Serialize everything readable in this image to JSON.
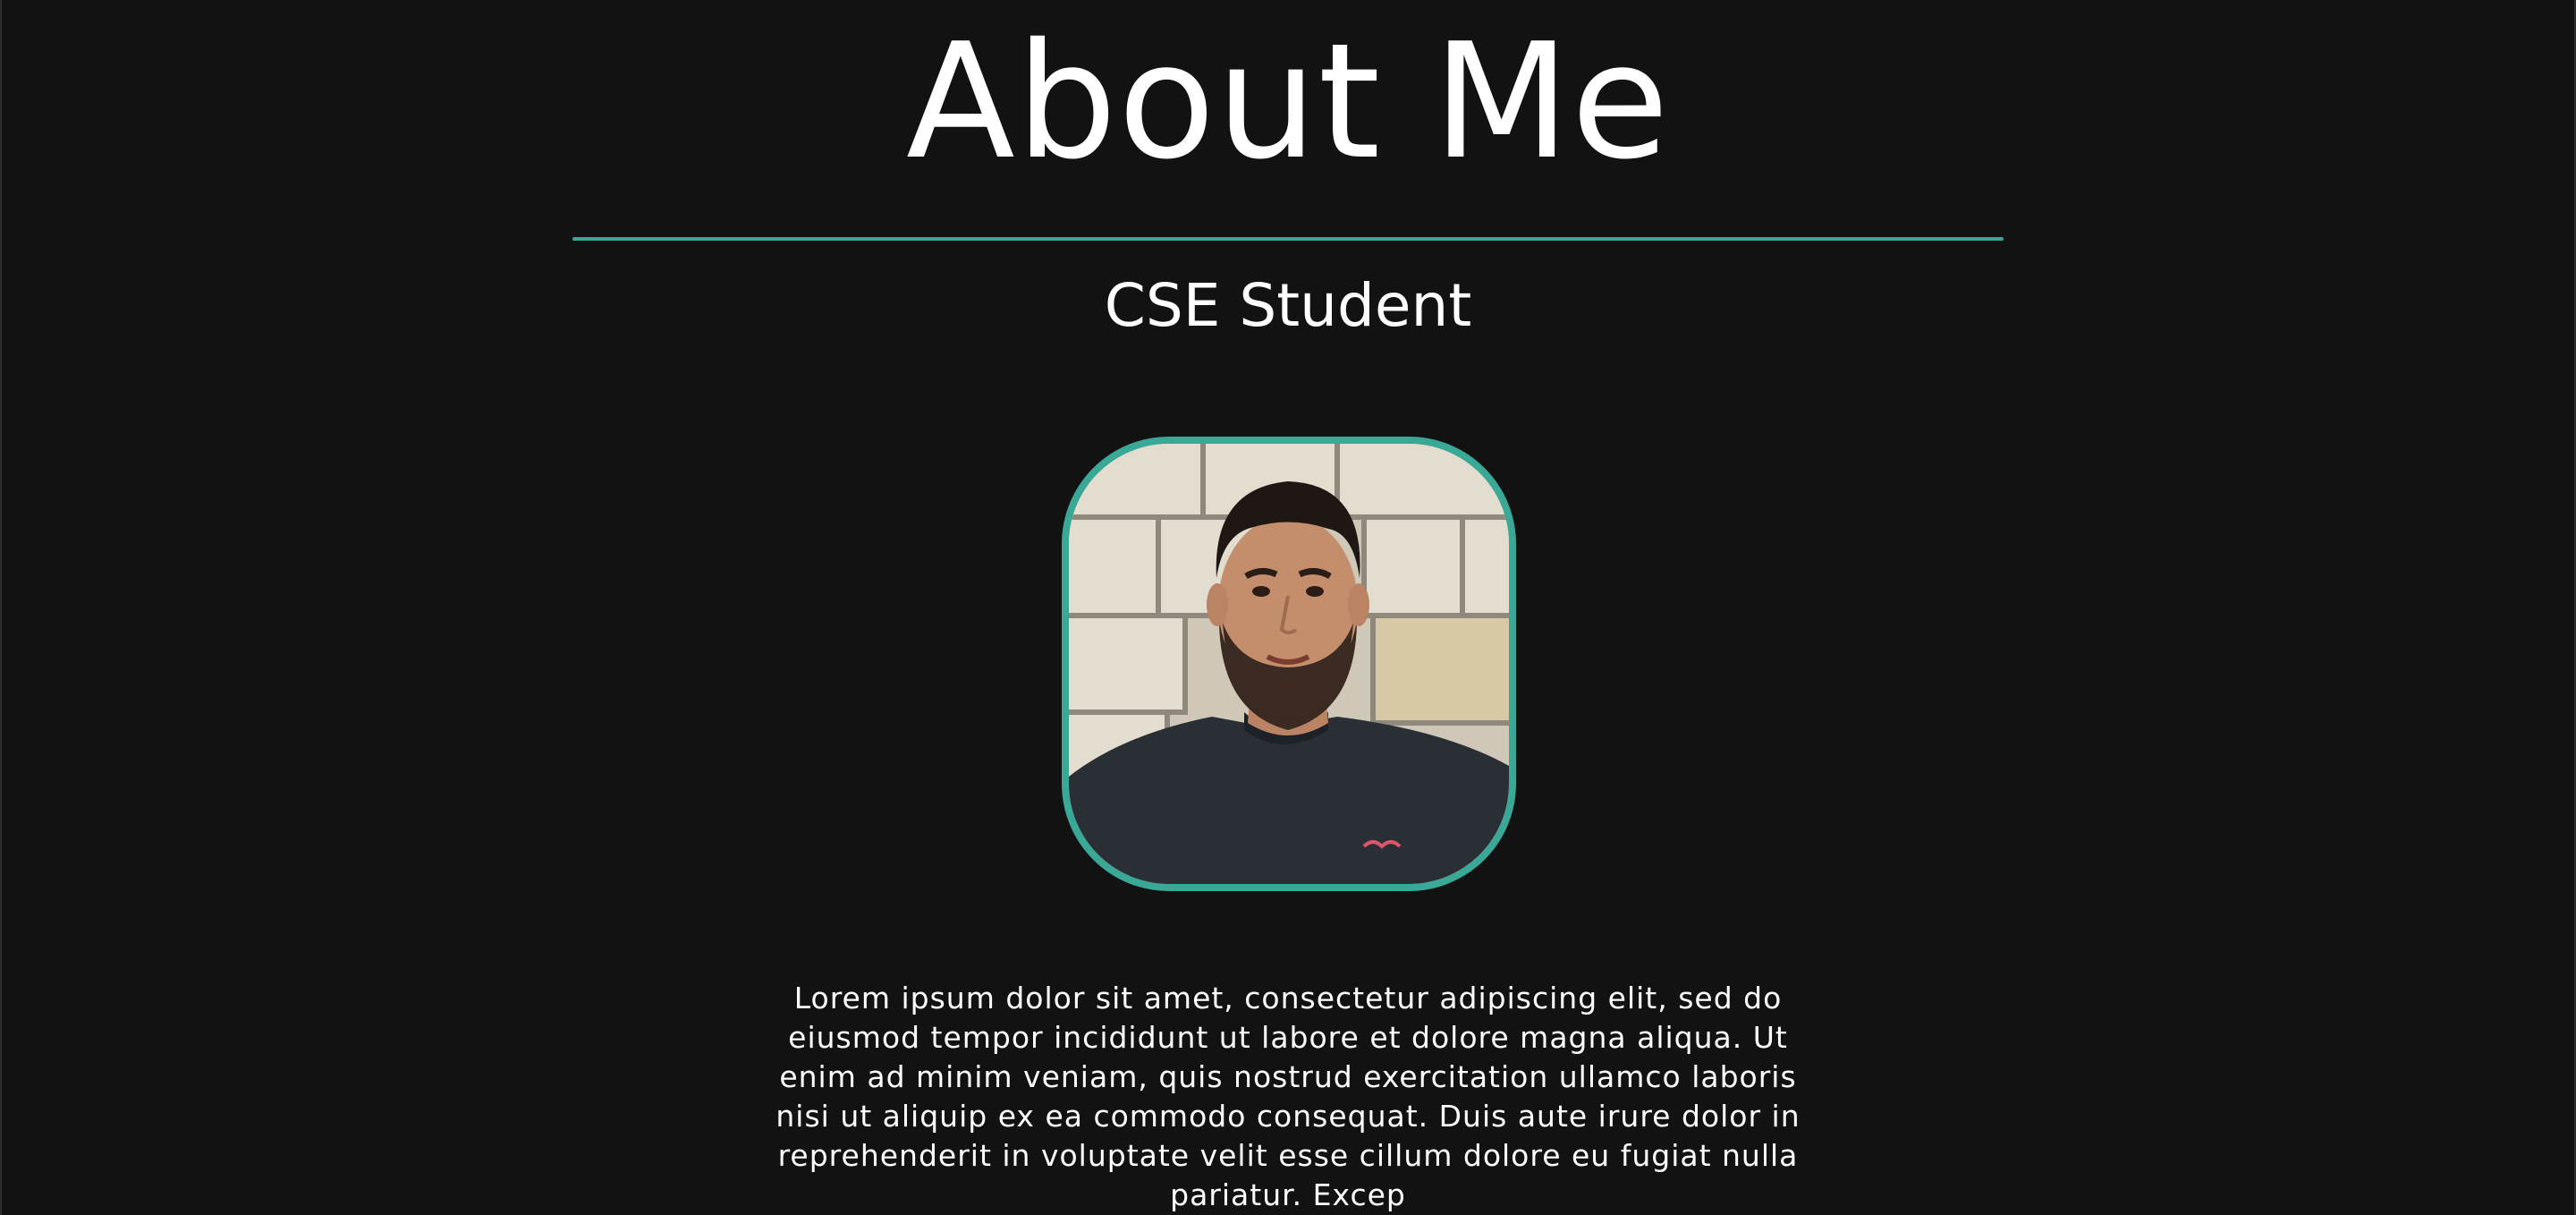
{
  "colors": {
    "background": "#121212",
    "accent": "#3aa896",
    "text": "#ffffff"
  },
  "header": {
    "title": "About Me",
    "subtitle": "CSE Student"
  },
  "profile": {
    "image_alt": "Profile photo",
    "image_icon": "profile-photo"
  },
  "bio": {
    "text": "Lorem ipsum dolor sit amet, consectetur adipiscing elit, sed do eiusmod tempor incididunt ut labore et dolore magna aliqua. Ut enim ad minim veniam, quis nostrud exercitation ullamco laboris nisi ut aliquip ex ea commodo consequat. Duis aute irure dolor in reprehenderit in voluptate velit esse cillum dolore eu fugiat nulla pariatur. Excep"
  }
}
